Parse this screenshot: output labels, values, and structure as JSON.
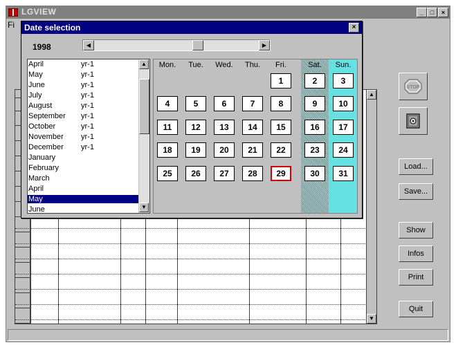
{
  "app": {
    "title": "LGVIEW",
    "menu_stub": "Fi"
  },
  "controls": {
    "minimize": "_",
    "maximize": "□",
    "close": "×"
  },
  "side_buttons": {
    "stop_icon": "stop-sign-icon",
    "safe_icon": "safe-icon",
    "load": "Load...",
    "save": "Save...",
    "show": "Show",
    "infos": "Infos",
    "print": "Print",
    "quit": "Quit"
  },
  "dialog": {
    "title": "Date selection",
    "close": "×",
    "year": "1998",
    "months": [
      {
        "name": "April",
        "yr": "yr-1",
        "selected": false
      },
      {
        "name": "May",
        "yr": "yr-1",
        "selected": false
      },
      {
        "name": "June",
        "yr": "yr-1",
        "selected": false
      },
      {
        "name": "July",
        "yr": "yr-1",
        "selected": false
      },
      {
        "name": "August",
        "yr": "yr-1",
        "selected": false
      },
      {
        "name": "September",
        "yr": "yr-1",
        "selected": false
      },
      {
        "name": "October",
        "yr": "yr-1",
        "selected": false
      },
      {
        "name": "November",
        "yr": "yr-1",
        "selected": false
      },
      {
        "name": "December",
        "yr": "yr-1",
        "selected": false
      },
      {
        "name": "January",
        "yr": "",
        "selected": false
      },
      {
        "name": "February",
        "yr": "",
        "selected": false
      },
      {
        "name": "March",
        "yr": "",
        "selected": false
      },
      {
        "name": "April",
        "yr": "",
        "selected": false
      },
      {
        "name": "May",
        "yr": "",
        "selected": true
      },
      {
        "name": "June",
        "yr": "",
        "selected": false
      }
    ],
    "weekdays": [
      "Mon.",
      "Tue.",
      "Wed.",
      "Thu.",
      "Fri.",
      "Sat.",
      "Sun."
    ],
    "weeks": [
      [
        "",
        "",
        "",
        "",
        "1",
        "2",
        "3"
      ],
      [
        "4",
        "5",
        "6",
        "7",
        "8",
        "9",
        "10"
      ],
      [
        "11",
        "12",
        "13",
        "14",
        "15",
        "16",
        "17"
      ],
      [
        "18",
        "19",
        "20",
        "21",
        "22",
        "23",
        "24"
      ],
      [
        "25",
        "26",
        "27",
        "28",
        "29",
        "30",
        "31"
      ]
    ],
    "today": "29"
  },
  "colors": {
    "titlebar_active": "#000080",
    "titlebar_inactive": "#808080",
    "sunday": "#66e0e0",
    "today_border": "#d00000"
  }
}
